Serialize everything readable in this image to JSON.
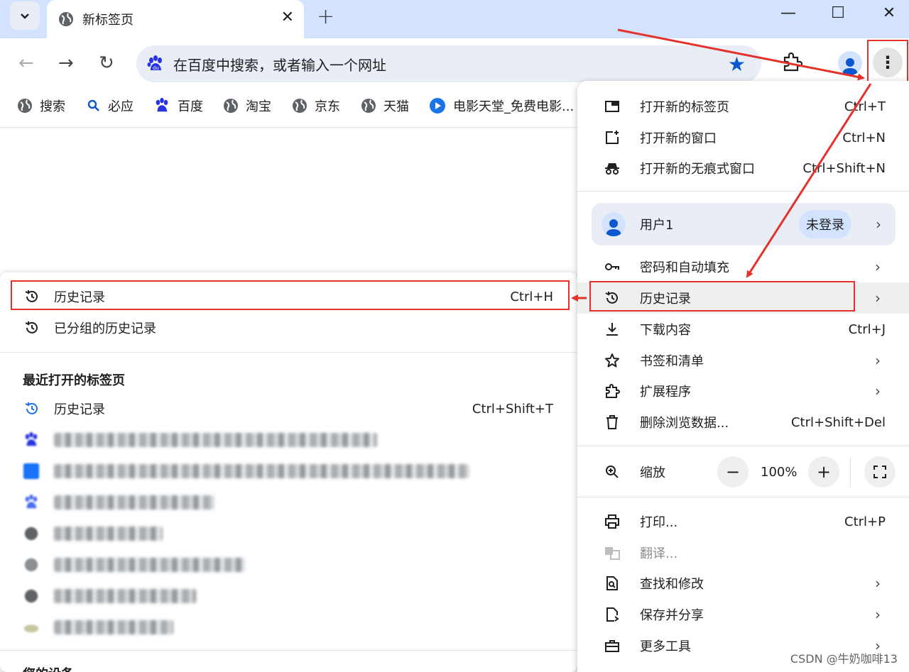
{
  "tab": {
    "title": "新标签页",
    "close": "✕",
    "new_tab": "+"
  },
  "window_controls": {
    "minimize": "—",
    "maximize": "☐",
    "close": "✕"
  },
  "nav": {
    "back": "←",
    "forward": "→",
    "reload": "↻"
  },
  "omnibox": {
    "text": "在百度中搜索，或者输入一个网址",
    "bookmark_icon": "star-icon"
  },
  "bookmarks": [
    {
      "label": "搜索",
      "icon": "globe-icon"
    },
    {
      "label": "必应",
      "icon": "search-icon"
    },
    {
      "label": "百度",
      "icon": "baidu-paw-icon"
    },
    {
      "label": "淘宝",
      "icon": "globe-icon"
    },
    {
      "label": "京东",
      "icon": "globe-icon"
    },
    {
      "label": "天猫",
      "icon": "globe-icon"
    },
    {
      "label": "电影天堂_免费电影...",
      "icon": "play-icon"
    }
  ],
  "menu": {
    "new_tab": {
      "label": "打开新的标签页",
      "shortcut": "Ctrl+T"
    },
    "new_window": {
      "label": "打开新的窗口",
      "shortcut": "Ctrl+N"
    },
    "incognito": {
      "label": "打开新的无痕式窗口",
      "shortcut": "Ctrl+Shift+N"
    },
    "profile": {
      "name": "用户1",
      "status": "未登录"
    },
    "passwords": {
      "label": "密码和自动填充"
    },
    "history": {
      "label": "历史记录"
    },
    "downloads": {
      "label": "下载内容",
      "shortcut": "Ctrl+J"
    },
    "bookmarks": {
      "label": "书签和清单"
    },
    "extensions": {
      "label": "扩展程序"
    },
    "clear_data": {
      "label": "删除浏览数据...",
      "shortcut": "Ctrl+Shift+Del"
    },
    "zoom": {
      "label": "缩放",
      "minus": "−",
      "value": "100%",
      "plus": "+"
    },
    "print": {
      "label": "打印...",
      "shortcut": "Ctrl+P"
    },
    "translate": {
      "label": "翻译..."
    },
    "find": {
      "label": "查找和修改"
    },
    "save_share": {
      "label": "保存并分享"
    },
    "more_tools": {
      "label": "更多工具"
    }
  },
  "history_submenu": {
    "history": {
      "label": "历史记录",
      "shortcut": "Ctrl+H"
    },
    "grouped": {
      "label": "已分组的历史记录"
    },
    "recent_heading": "最近打开的标签页",
    "recent_history": {
      "label": "历史记录",
      "shortcut": "Ctrl+Shift+T"
    },
    "blurred_items": [
      {
        "icon": "baidu-paw-icon"
      },
      {
        "icon": "zhihu-icon"
      },
      {
        "icon": "baidu-paw-icon"
      },
      {
        "icon": "globe-icon"
      },
      {
        "icon": "globe-icon"
      },
      {
        "icon": "globe-icon"
      },
      {
        "icon": "globe-icon"
      }
    ],
    "bottom_heading_partial": "您的设备"
  },
  "watermark": "CSDN @牛奶咖啡13",
  "colors": {
    "accent": "#0b57d0",
    "annotation_red": "#e5312b",
    "tabstrip": "#d3e3fd",
    "omnibox": "#e9eef6"
  }
}
